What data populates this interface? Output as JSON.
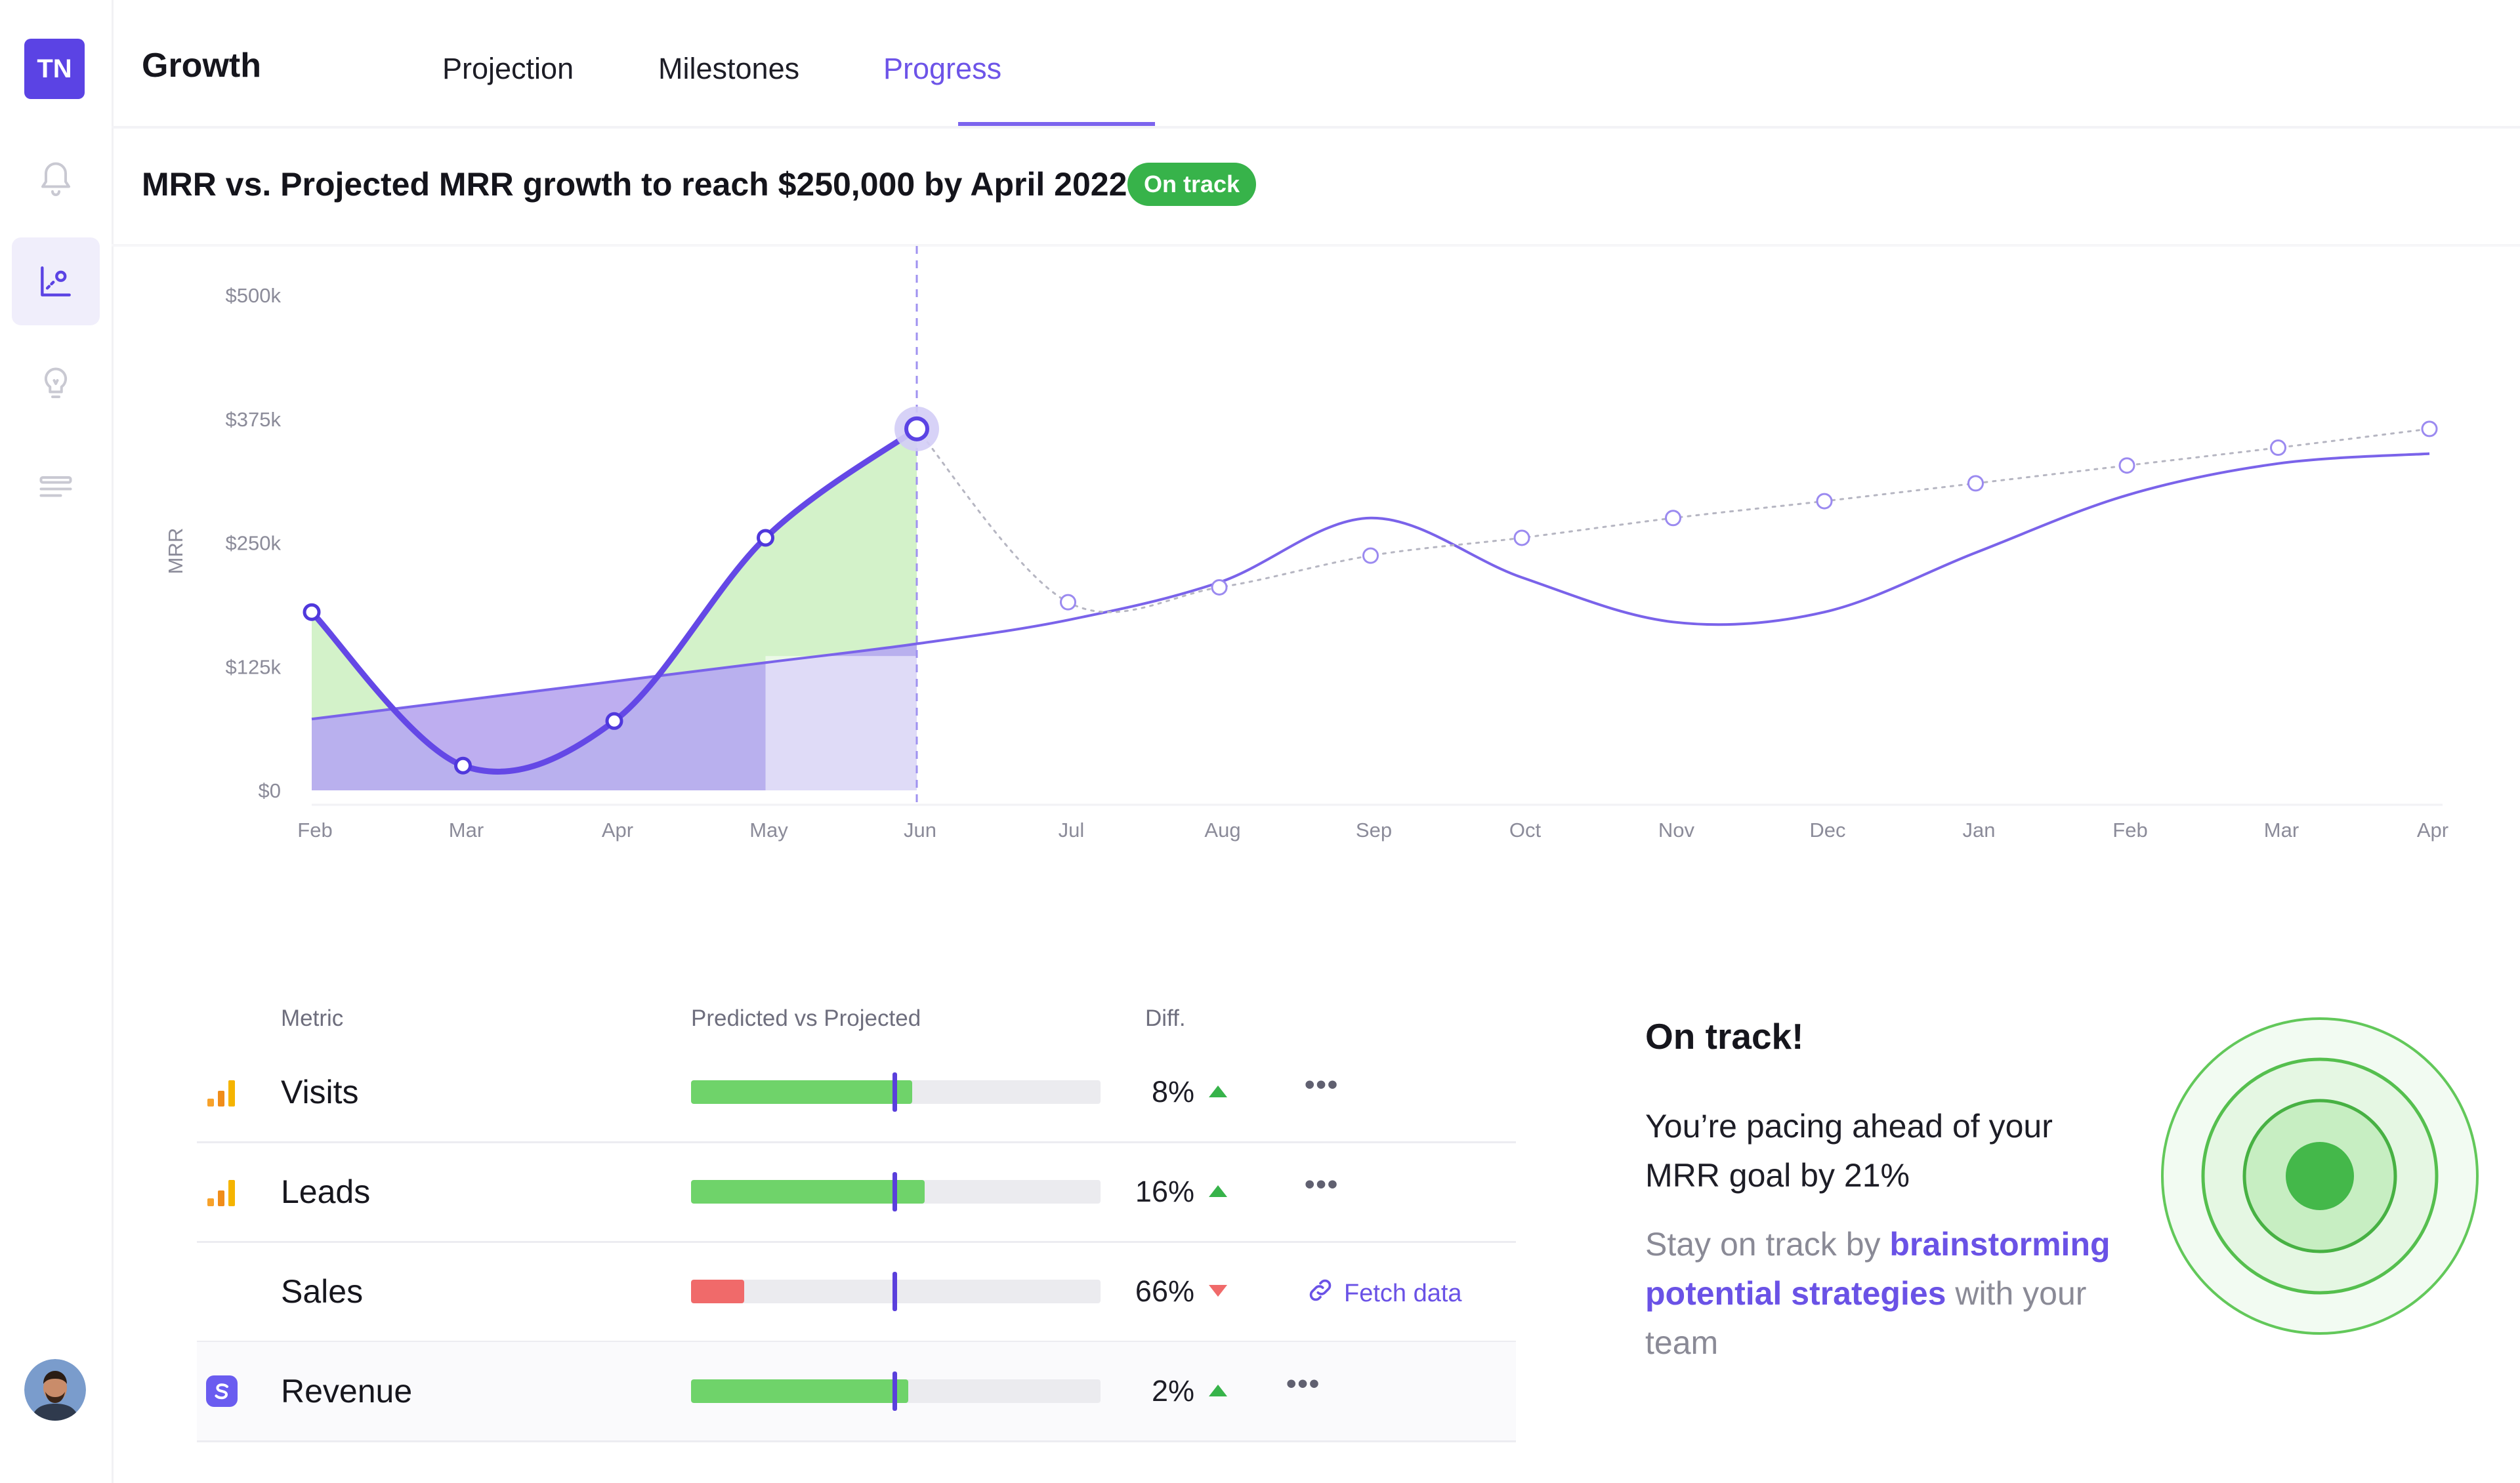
{
  "sidebar": {
    "logo_text": "TN",
    "icons": [
      "bell-icon",
      "chart-icon",
      "lightbulb-icon",
      "list-icon"
    ],
    "avatar": "user-avatar"
  },
  "header": {
    "title": "Growth",
    "tabs": [
      "Projection",
      "Milestones",
      "Progress"
    ],
    "active_tab": "Progress"
  },
  "chart_title": "MRR vs. Projected MRR growth to reach $250,000 by April 2022",
  "status_badge": "On track",
  "chart_data": {
    "type": "line",
    "ylabel": "MRR",
    "y_ticks": [
      "$0",
      "$125k",
      "$250k",
      "$375k",
      "$500k"
    ],
    "ylim": [
      0,
      500000
    ],
    "x_ticks": [
      "Feb",
      "Mar",
      "Apr",
      "May",
      "Jun",
      "Jul",
      "Aug",
      "Sep",
      "Oct",
      "Nov",
      "Dec",
      "Jan",
      "Feb",
      "Mar",
      "Apr"
    ],
    "series": [
      {
        "values": [
          180000,
          25000,
          70000,
          255000,
          365000
        ]
      },
      {
        "values": [
          190000,
          205000,
          237000,
          255000,
          275000,
          292000,
          310000,
          328000,
          346000,
          365000
        ]
      },
      {
        "values": [
          72000,
          91000,
          110000,
          129000,
          148000,
          172000,
          210000,
          275000,
          215000,
          170000,
          180000,
          240000,
          298000,
          330000,
          340000
        ]
      }
    ],
    "highlight_month": "Jun"
  },
  "table": {
    "headers": {
      "metric": "Metric",
      "predicted": "Predicted vs Projected",
      "diff": "Diff."
    },
    "rows": [
      {
        "label": "Visits",
        "fill": 0.54,
        "status": "positive",
        "diff": "8%",
        "trend": "up",
        "icon": "bar-chart-icon",
        "action": "more"
      },
      {
        "label": "Leads",
        "fill": 0.57,
        "status": "positive",
        "diff": "16%",
        "trend": "up",
        "icon": "bar-chart-icon",
        "action": "more"
      },
      {
        "label": "Sales",
        "fill": 0.13,
        "status": "negative",
        "diff": "66%",
        "trend": "down",
        "icon": "",
        "action": "Fetch data"
      },
      {
        "label": "Revenue",
        "fill": 0.53,
        "status": "positive",
        "diff": "2%",
        "trend": "up",
        "icon": "stripe-icon",
        "action": "more"
      }
    ],
    "more_label": "•••"
  },
  "panel": {
    "title": "On track!",
    "text": "You’re pacing ahead of your MRR goal by 21%",
    "sub_before": "Stay on track by ",
    "sub_link": "brainstorming potential strategies",
    "sub_after": " with your team"
  },
  "colors": {
    "accent": "#6d54e8",
    "success": "#37b34a",
    "danger": "#f06a6a",
    "bar_green": "#6fd36a"
  }
}
